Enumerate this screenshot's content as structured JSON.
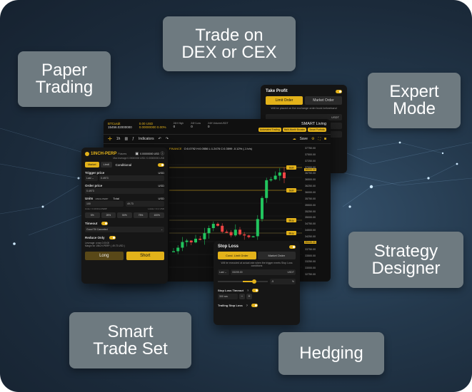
{
  "tags": {
    "paper_trading_line1": "Paper",
    "paper_trading_line2": "Trading",
    "trade_on_line1": "Trade on",
    "trade_on_line2": "DEX or CEX",
    "expert_line1": "Expert",
    "expert_line2": "Mode",
    "strategy_line1": "Strategy",
    "strategy_line2": "Designer",
    "smart_line1": "Smart",
    "smart_line2": "Trade Set",
    "hedging": "Hedging"
  },
  "take_profit": {
    "title": "Take Profit",
    "tab_limit": "Limit Order",
    "tab_market": "Market Order",
    "note": "Will be placed on the exchange order book beforehand",
    "currency": "USDT"
  },
  "chart_window": {
    "pair": "BTCusdt",
    "price_usd": "0.00 USD",
    "price_value": "15456.02000000",
    "change": "0.00000000 0.00%",
    "high_label": "24H High",
    "high_value": "0",
    "low_label": "24H Low",
    "low_value": "0",
    "volume_label": "24H VolumeUSDT",
    "volume_value": "0",
    "smart_living": "SMART Living",
    "btn_automated": "Automated Trading",
    "btn_multi": "Multi-Month Booster",
    "btn_smart": "Smart Portfolio",
    "indicators": "Indicators",
    "save": "Save",
    "ohlc": "O:0.0792  H:0.0556  L:1.2476  C:0.3599  -0.12% (-1 h/s)",
    "source": "FINANCE",
    "axis_labels": [
      "37750.00",
      "37500.00",
      "37250.00",
      "37000.00",
      "36750.00",
      "36500.00",
      "36250.00",
      "36000.00",
      "35750.00",
      "35500.00",
      "35250.00",
      "35000.00",
      "34750.00",
      "34500.00",
      "34250.00",
      "34000.00",
      "33750.00",
      "33500.00",
      "33250.00",
      "33000.00",
      "32750.00"
    ],
    "sell_tag": "Sell",
    "buy_tag": "Buy",
    "line_price_1": "36500.00",
    "line_price_2": "35445.00"
  },
  "order_panel": {
    "pair": "1INCH-PERP",
    "pair_sub": "Futures",
    "balance": "0.00000000 USD",
    "max_leverage": "Max leverage 0.00000000 USD / 0.00000000 USD",
    "tab_market": "Market",
    "tab_limit": "Limit",
    "tab_conditional": "Conditional",
    "trigger_label": "Trigger price",
    "trigger_currency": "USD",
    "trigger_type": "Last",
    "trigger_value": "0.4973",
    "order_price_label": "Order price",
    "order_price_currency": "USD",
    "order_price_value": "0.4973",
    "units_label": "Units",
    "units_sub": "1INCH-PERP",
    "total_label": "Total",
    "total_currency": "USD",
    "units_value": "100",
    "total_value": "49.73",
    "units_note": "Units = 0.1INCH-PERP",
    "total_note": "Limits = 0.1 USD",
    "pct": [
      "5%",
      "25%",
      "50%",
      "75%",
      "100%"
    ],
    "timeout_label": "Timeout",
    "timeout_value": "Good Till Canceled",
    "reduce_only": "Reduce Only",
    "leverage_note": "Leverage: cross 0.00:00",
    "margin_note": "Margin for 1INCH-PERP: ( 49.73 USD )",
    "long": "Long",
    "short": "Short"
  },
  "stop_loss": {
    "title": "Stop Loss",
    "tab_limit": "Cond. Limit Order",
    "tab_market": "Market Order",
    "note": "Will be executed at actual rate when the trigger meets Stop Loss conditions",
    "type": "Last",
    "price": "33205.00",
    "currency": "USDT",
    "pct": "-5",
    "pct_unit": "%",
    "timeout_label": "Stop Loss Timeout",
    "timeout_value": "300",
    "timeout_unit": "sec",
    "trailing_label": "Trailing Stop Loss"
  },
  "colors": {
    "accent": "#e3b21a",
    "bull": "#22c55e",
    "bear": "#ef4444",
    "tag_bg": "#6e7a80"
  }
}
